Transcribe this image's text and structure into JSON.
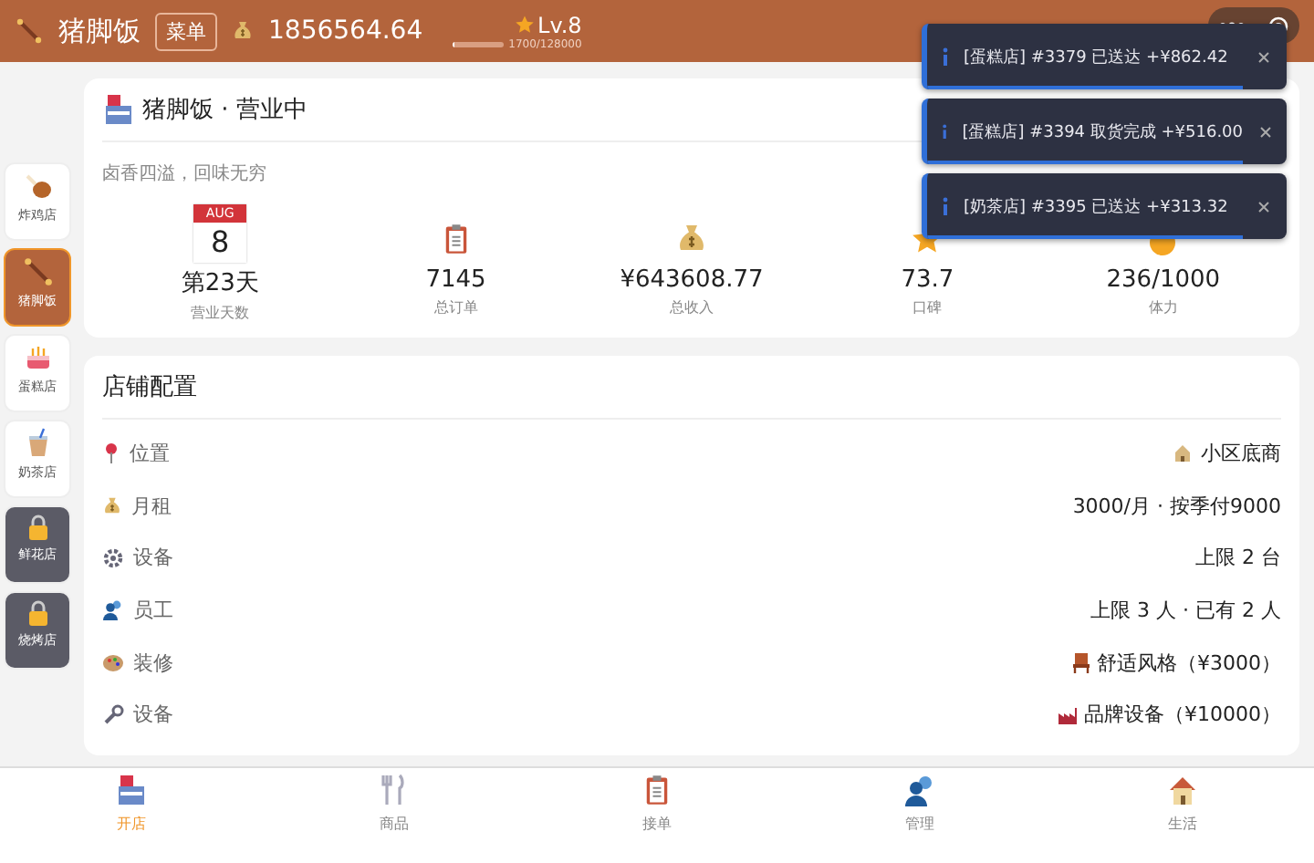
{
  "header": {
    "shop_name": "猪脚饭",
    "menu_button": "菜单",
    "money": "1856564.64",
    "level": "Lv.8",
    "xp": {
      "text": "1700/128000",
      "level": 0.0133
    }
  },
  "sidebar": {
    "items": [
      {
        "label": "炸鸡店",
        "selected": false,
        "locked": false
      },
      {
        "label": "猪脚饭",
        "selected": true,
        "locked": false
      },
      {
        "label": "蛋糕店",
        "selected": false,
        "locked": false
      },
      {
        "label": "奶茶店",
        "selected": false,
        "locked": false
      },
      {
        "label": "鲜花店",
        "selected": false,
        "locked": true
      },
      {
        "label": "烧烤店",
        "selected": false,
        "locked": true
      }
    ]
  },
  "overview": {
    "title": "猪脚饭 · 营业中",
    "slogan": "卤香四溢，回味无穷",
    "stats": [
      {
        "kind": "calendar",
        "month": "AUG",
        "day": "8",
        "value": "第23天",
        "label": "营业天数"
      },
      {
        "kind": "icon",
        "value": "7145",
        "label": "总订单"
      },
      {
        "kind": "icon",
        "value": "¥643608.77",
        "label": "总收入"
      },
      {
        "kind": "icon",
        "value": "73.7",
        "label": "口碑"
      },
      {
        "kind": "icon",
        "value": "236/1000",
        "label": "体力"
      }
    ]
  },
  "config": {
    "title": "店铺配置",
    "rows": [
      {
        "label": "位置",
        "value": "小区底商"
      },
      {
        "label": "月租",
        "value": "3000/月 · 按季付9000"
      },
      {
        "label": "设备",
        "value": "上限 2 台"
      },
      {
        "label": "员工",
        "value": "上限 3 人 · 已有 2 人"
      },
      {
        "label": "装修",
        "value": "舒适风格（¥3000）"
      },
      {
        "label": "设备",
        "value": "品牌设备（¥10000）"
      }
    ]
  },
  "toasts": [
    {
      "text": "[蛋糕店] #3379 已送达 +¥862.42",
      "level": 0.88
    },
    {
      "text": "[蛋糕店] #3394 取货完成 +¥516.00",
      "level": 0.88
    },
    {
      "text": "[奶茶店] #3395 已送达 +¥313.32",
      "level": 0.88
    }
  ],
  "tabs": [
    {
      "label": "开店",
      "selected": true
    },
    {
      "label": "商品",
      "selected": false
    },
    {
      "label": "接单",
      "selected": false
    },
    {
      "label": "管理",
      "selected": false
    },
    {
      "label": "生活",
      "selected": false
    }
  ]
}
